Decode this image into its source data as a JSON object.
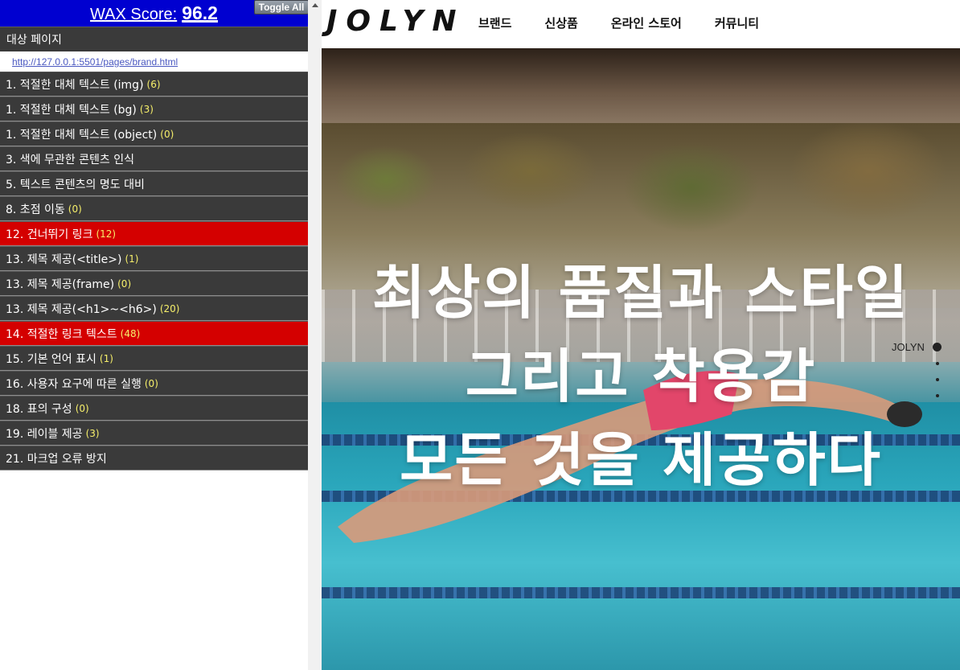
{
  "wax": {
    "score_label": "WAX Score:",
    "score_value": "96.2",
    "toggle_label": "Toggle All",
    "target_title": "대상 페이지",
    "target_url": "http://127.0.0.1:5501/pages/brand.html",
    "items": [
      {
        "label": "1. 적절한 대체 텍스트 (img)",
        "count": "(6)",
        "status": "normal"
      },
      {
        "label": "1. 적절한 대체 텍스트 (bg)",
        "count": "(3)",
        "status": "normal"
      },
      {
        "label": "1. 적절한 대체 텍스트 (object)",
        "count": "(0)",
        "status": "normal"
      },
      {
        "label": "3. 색에 무관한 콘텐츠 인식",
        "count": "",
        "status": "normal"
      },
      {
        "label": "5. 텍스트 콘텐츠의 명도 대비",
        "count": "",
        "status": "normal"
      },
      {
        "label": "8. 초점 이동",
        "count": "(0)",
        "status": "normal"
      },
      {
        "label": "12. 건너뛰기 링크",
        "count": "(12)",
        "status": "fail"
      },
      {
        "label": "13. 제목 제공(<title>)",
        "count": "(1)",
        "status": "normal"
      },
      {
        "label": "13. 제목 제공(frame)",
        "count": "(0)",
        "status": "normal"
      },
      {
        "label": "13. 제목 제공(<h1>~<h6>)",
        "count": "(20)",
        "status": "normal"
      },
      {
        "label": "14. 적절한 링크 텍스트",
        "count": "(48)",
        "status": "fail"
      },
      {
        "label": "15. 기본 언어 표시",
        "count": "(1)",
        "status": "normal"
      },
      {
        "label": "16. 사용자 요구에 따른 실행",
        "count": "(0)",
        "status": "normal"
      },
      {
        "label": "18. 표의 구성",
        "count": "(0)",
        "status": "normal"
      },
      {
        "label": "19. 레이블 제공",
        "count": "(3)",
        "status": "normal"
      },
      {
        "label": "21. 마크업 오류 방지",
        "count": "",
        "status": "normal"
      }
    ]
  },
  "site": {
    "logo": "JOLYN",
    "nav": [
      "브랜드",
      "신상품",
      "온라인 스토어",
      "커뮤니티"
    ],
    "hero_lines": [
      "최상의 품질과 스타일",
      "그리고 착용감",
      "모든 것을 제공하다"
    ],
    "pager_label": "JOLYN"
  },
  "colors": {
    "wax_header": "#0000d0",
    "item_bg": "#3a3a3a",
    "item_fail": "#d40000",
    "count_text": "#f6ef6a"
  }
}
